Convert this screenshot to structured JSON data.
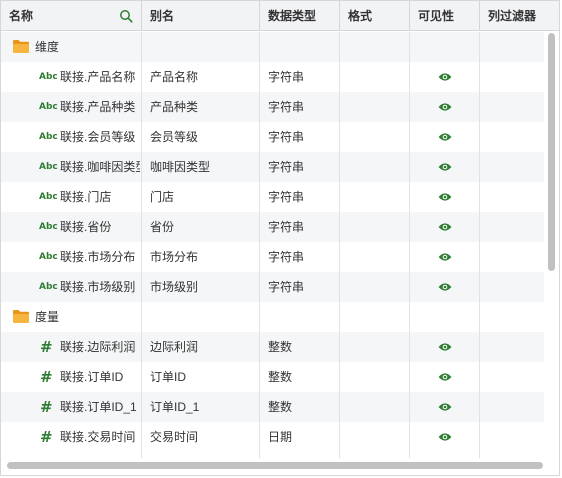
{
  "header": {
    "col_name": "名称",
    "col_alias": "别名",
    "col_type": "数据类型",
    "col_format": "格式",
    "col_visible": "可见性",
    "col_filter": "列过滤器"
  },
  "colors": {
    "accent_green": "#2e7d32",
    "folder": "#f5a623",
    "row_alt": "#f5f6f8",
    "header_bg": "#f2f3f5"
  },
  "rows": [
    {
      "kind": "group",
      "icon": "folder-icon",
      "name": "维度"
    },
    {
      "kind": "field",
      "icon": "text-type-icon",
      "badge": "Abc",
      "name": "联接.产品名称",
      "alias": "产品名称",
      "type": "字符串",
      "visible": true
    },
    {
      "kind": "field",
      "icon": "text-type-icon",
      "badge": "Abc",
      "name": "联接.产品种类",
      "alias": "产品种类",
      "type": "字符串",
      "visible": true
    },
    {
      "kind": "field",
      "icon": "text-type-icon",
      "badge": "Abc",
      "name": "联接.会员等级",
      "alias": "会员等级",
      "type": "字符串",
      "visible": true
    },
    {
      "kind": "field",
      "icon": "text-type-icon",
      "badge": "Abc",
      "name": "联接.咖啡因类型",
      "alias": "咖啡因类型",
      "type": "字符串",
      "visible": true
    },
    {
      "kind": "field",
      "icon": "text-type-icon",
      "badge": "Abc",
      "name": "联接.门店",
      "alias": "门店",
      "type": "字符串",
      "visible": true
    },
    {
      "kind": "field",
      "icon": "text-type-icon",
      "badge": "Abc",
      "name": "联接.省份",
      "alias": "省份",
      "type": "字符串",
      "visible": true
    },
    {
      "kind": "field",
      "icon": "text-type-icon",
      "badge": "Abc",
      "name": "联接.市场分布",
      "alias": "市场分布",
      "type": "字符串",
      "visible": true
    },
    {
      "kind": "field",
      "icon": "text-type-icon",
      "badge": "Abc",
      "name": "联接.市场级别",
      "alias": "市场级别",
      "type": "字符串",
      "visible": true
    },
    {
      "kind": "group",
      "icon": "folder-icon",
      "name": "度量"
    },
    {
      "kind": "field",
      "icon": "number-type-icon",
      "badge": "#",
      "name": "联接.边际利润",
      "alias": "边际利润",
      "type": "整数",
      "visible": true
    },
    {
      "kind": "field",
      "icon": "number-type-icon",
      "badge": "#",
      "name": "联接.订单ID",
      "alias": "订单ID",
      "type": "整数",
      "visible": true
    },
    {
      "kind": "field",
      "icon": "number-type-icon",
      "badge": "#",
      "name": "联接.订单ID_1",
      "alias": "订单ID_1",
      "type": "整数",
      "visible": true
    },
    {
      "kind": "field",
      "icon": "number-type-icon",
      "badge": "#",
      "name": "联接.交易时间",
      "alias": "交易时间",
      "type": "日期",
      "visible": true
    }
  ]
}
